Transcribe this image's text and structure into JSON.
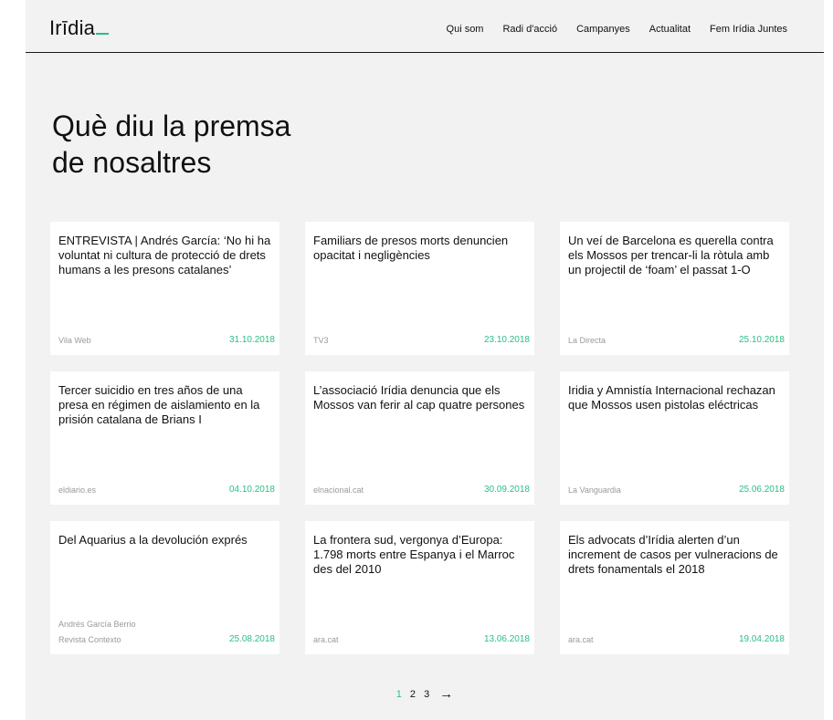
{
  "header": {
    "logo": "Irīdia",
    "nav": [
      "Qui som",
      "Radi d'acció",
      "Campanyes",
      "Actualitat",
      "Fem Irídia Juntes"
    ]
  },
  "page": {
    "title_line1": "Què diu la premsa",
    "title_line2": "de nosaltres"
  },
  "articles": [
    {
      "title": "ENTREVISTA | Andrés García: ‘No hi ha voluntat ni cultura de protecció de drets humans a les presons catalanes’",
      "author": "",
      "source": "Vila Web",
      "date": "31.10.2018"
    },
    {
      "title": "Familiars de presos morts denuncien opacitat i negligències",
      "author": "",
      "source": "TV3",
      "date": "23.10.2018"
    },
    {
      "title": "Un veí de Barcelona es querella contra els Mossos per trencar-li la ròtula amb un projectil de ‘foam’ el passat 1-O",
      "author": "",
      "source": "La Directa",
      "date": "25.10.2018"
    },
    {
      "title": "Tercer suicidio en tres años de una presa en régimen de aislamiento en la prisión catalana de Brians I",
      "author": "",
      "source": "eldiario.es",
      "date": "04.10.2018"
    },
    {
      "title": "L’associació Irídia denuncia que els Mossos van ferir al cap quatre persones",
      "author": "",
      "source": "elnacional.cat",
      "date": "30.09.2018"
    },
    {
      "title": "Iridia y Amnistía Internacional rechazan que Mossos usen pistolas eléctricas",
      "author": "",
      "source": "La Vanguardia",
      "date": "25.06.2018"
    },
    {
      "title": "Del Aquarius a la devolución exprés",
      "author": "Andrés García Berrio",
      "source": "Revista Contexto",
      "date": "25.08.2018"
    },
    {
      "title": "La frontera sud, vergonya d’Europa: 1.798 morts entre Espanya i el Marroc des del 2010",
      "author": "",
      "source": "ara.cat",
      "date": "13.06.2018"
    },
    {
      "title": "Els advocats d’Irídia alerten d’un increment de casos per vulneracions de drets fonamentals el 2018",
      "author": "",
      "source": "ara.cat",
      "date": "19.04.2018"
    }
  ],
  "pagination": {
    "pages": [
      "1",
      "2",
      "3"
    ],
    "current": "1",
    "next_arrow": "→"
  },
  "colors": {
    "accent": "#2bbf84",
    "background": "#f2f2f2",
    "card": "#ffffff",
    "text": "#111111",
    "muted": "#9a9a9a"
  }
}
